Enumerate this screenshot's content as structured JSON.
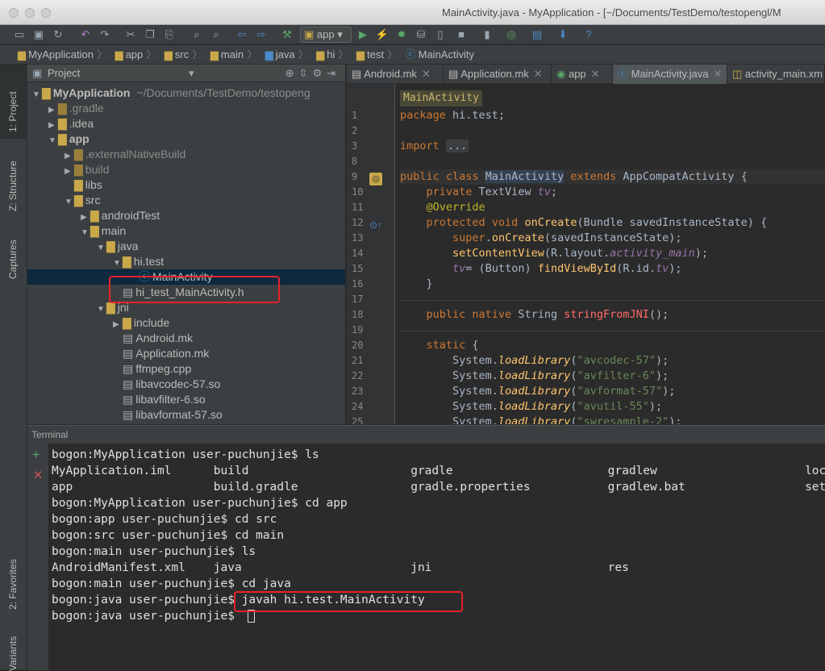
{
  "window": {
    "title": "MainActivity.java - MyApplication - [~/Documents/TestDemo/testopengl/M"
  },
  "toolbar": {
    "run_config": "app"
  },
  "breadcrumb": [
    "MyApplication",
    "app",
    "src",
    "main",
    "java",
    "hi",
    "test",
    "MainActivity"
  ],
  "sidebar": {
    "project_tab": "1: Project",
    "structure_tab": "Z: Structure",
    "captures_tab": "Captures",
    "favorites_tab": "2: Favorites",
    "variants_tab": "Variants"
  },
  "project": {
    "header": "Project",
    "tree": [
      {
        "label": "MyApplication",
        "suffix": "~/Documents/TestDemo/testopeng",
        "depth": 0,
        "kind": "folder",
        "expanded": true,
        "bold": true
      },
      {
        "label": ".gradle",
        "depth": 1,
        "kind": "folder",
        "expanded": false,
        "dim": true
      },
      {
        "label": ".idea",
        "depth": 1,
        "kind": "folder",
        "expanded": false
      },
      {
        "label": "app",
        "depth": 1,
        "kind": "folder",
        "expanded": true,
        "bold": true
      },
      {
        "label": ".externalNativeBuild",
        "depth": 2,
        "kind": "folder",
        "expanded": false,
        "dim": true
      },
      {
        "label": "build",
        "depth": 2,
        "kind": "folder",
        "expanded": false,
        "dim": true
      },
      {
        "label": "libs",
        "depth": 2,
        "kind": "folder",
        "leaf": true
      },
      {
        "label": "src",
        "depth": 2,
        "kind": "folder",
        "expanded": true
      },
      {
        "label": "androidTest",
        "depth": 3,
        "kind": "folder",
        "expanded": false
      },
      {
        "label": "main",
        "depth": 3,
        "kind": "folder",
        "expanded": true
      },
      {
        "label": "java",
        "depth": 4,
        "kind": "folder",
        "expanded": true
      },
      {
        "label": "hi.test",
        "depth": 5,
        "kind": "folder",
        "expanded": true
      },
      {
        "label": "MainActivity",
        "depth": 6,
        "kind": "class",
        "selected": true
      },
      {
        "label": "hi_test_MainActivity.h",
        "depth": 5,
        "kind": "file",
        "leaf": true
      },
      {
        "label": "jni",
        "depth": 4,
        "kind": "folder",
        "expanded": true
      },
      {
        "label": "include",
        "depth": 5,
        "kind": "folder",
        "expanded": false
      },
      {
        "label": "Android.mk",
        "depth": 5,
        "kind": "file",
        "leaf": true
      },
      {
        "label": "Application.mk",
        "depth": 5,
        "kind": "file",
        "leaf": true
      },
      {
        "label": "ffmpeg.cpp",
        "depth": 5,
        "kind": "file",
        "leaf": true
      },
      {
        "label": "libavcodec-57.so",
        "depth": 5,
        "kind": "file",
        "leaf": true
      },
      {
        "label": "libavfilter-6.so",
        "depth": 5,
        "kind": "file",
        "leaf": true
      },
      {
        "label": "libavformat-57.so",
        "depth": 5,
        "kind": "file",
        "leaf": true
      }
    ]
  },
  "editor": {
    "tabs": [
      "Android.mk",
      "Application.mk",
      "app",
      "MainActivity.java",
      "activity_main.xm"
    ],
    "active_tab": 3,
    "crumb": "MainActivity",
    "line_numbers": [
      "1",
      "2",
      "3",
      "8",
      "9",
      "10",
      "11",
      "12",
      "13",
      "14",
      "15",
      "16",
      "17",
      "18",
      "19",
      "20",
      "21",
      "22",
      "23",
      "24",
      "25"
    ]
  },
  "terminal": {
    "title": "Terminal",
    "lines": [
      "bogon:MyApplication user-puchunjie$ ls",
      "MyApplication.iml      build                       gradle                      gradlew                     local.prope",
      "app                    build.gradle                gradle.properties           gradlew.bat                 settings.gr",
      "bogon:MyApplication user-puchunjie$ cd app",
      "bogon:app user-puchunjie$ cd src",
      "bogon:src user-puchunjie$ cd main",
      "bogon:main user-puchunjie$ ls",
      "AndroidManifest.xml    java                        jni                         res",
      "bogon:main user-puchunjie$ cd java",
      "bogon:java user-puchunjie$ javah hi.test.MainActivity",
      "bogon:java user-puchunjie$ "
    ]
  }
}
